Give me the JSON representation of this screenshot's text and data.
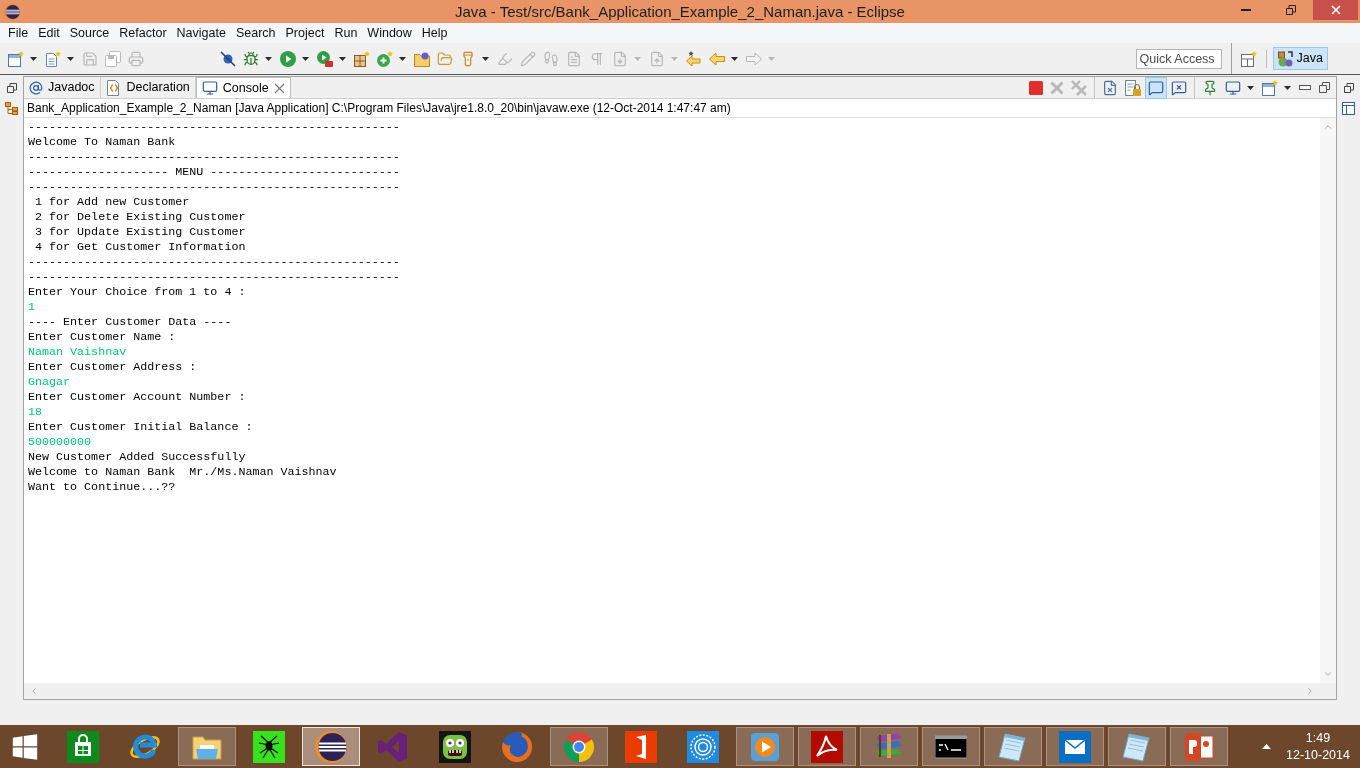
{
  "window": {
    "title": "Java - Test/src/Bank_Application_Example_2_Naman.java - Eclipse"
  },
  "menu_bar": [
    "File",
    "Edit",
    "Source",
    "Refactor",
    "Navigate",
    "Search",
    "Project",
    "Run",
    "Window",
    "Help"
  ],
  "toolbar": {
    "groups": [
      [
        {
          "kind": "new",
          "dropdown": true,
          "disabled": false
        },
        {
          "kind": "new-file",
          "dropdown": true,
          "disabled": false
        },
        {
          "kind": "save",
          "dropdown": false,
          "disabled": true
        },
        {
          "kind": "save-all",
          "dropdown": false,
          "disabled": true
        },
        {
          "kind": "print",
          "dropdown": false,
          "disabled": true
        }
      ],
      [
        {
          "kind": "skip-breakpoints",
          "dropdown": false,
          "disabled": false
        },
        {
          "kind": "debug",
          "dropdown": true,
          "disabled": false
        },
        {
          "kind": "run",
          "dropdown": true,
          "disabled": false
        },
        {
          "kind": "external-tools",
          "dropdown": true,
          "disabled": false
        },
        {
          "kind": "new-project",
          "dropdown": false,
          "disabled": false
        },
        {
          "kind": "new-class",
          "dropdown": true,
          "disabled": false
        },
        {
          "kind": "open-type",
          "dropdown": false,
          "disabled": false
        },
        {
          "kind": "open-task",
          "dropdown": false,
          "disabled": false
        },
        {
          "kind": "search",
          "dropdown": true,
          "disabled": false
        },
        {
          "kind": "mark-occurrences",
          "dropdown": false,
          "disabled": true
        },
        {
          "kind": "edit",
          "dropdown": false,
          "disabled": true
        },
        {
          "kind": "breadcrumb",
          "dropdown": false,
          "disabled": true
        },
        {
          "kind": "source-only",
          "dropdown": false,
          "disabled": true
        },
        {
          "kind": "whitespace",
          "dropdown": false,
          "disabled": true
        },
        {
          "kind": "next-annotation",
          "dropdown": true,
          "disabled": true
        },
        {
          "kind": "previous-annotation",
          "dropdown": true,
          "disabled": true
        },
        {
          "kind": "last-edit",
          "dropdown": false,
          "disabled": false
        },
        {
          "kind": "back",
          "dropdown": true,
          "disabled": false
        },
        {
          "kind": "forward",
          "dropdown": true,
          "disabled": true
        }
      ]
    ],
    "quick_access": {
      "placeholder": "Quick Access"
    },
    "perspectives": [
      {
        "label": "Java",
        "selected": true
      }
    ]
  },
  "view": {
    "tabs": [
      {
        "kind": "javadoc",
        "label": "Javadoc",
        "selected": false
      },
      {
        "kind": "declaration",
        "label": "Declaration",
        "selected": false
      },
      {
        "kind": "console",
        "label": "Console",
        "selected": true
      }
    ],
    "toolbar_groups": [
      [
        {
          "kind": "terminate",
          "dropdown": false,
          "disabled": false,
          "selected": false
        },
        {
          "kind": "remove-launch",
          "dropdown": false,
          "disabled": true,
          "selected": false
        },
        {
          "kind": "remove-all",
          "dropdown": false,
          "disabled": true,
          "selected": false
        }
      ],
      [
        {
          "kind": "clear",
          "dropdown": false,
          "disabled": false,
          "selected": false
        },
        {
          "kind": "scroll-lock",
          "dropdown": false,
          "disabled": false,
          "selected": false
        },
        {
          "kind": "show-stdout",
          "dropdown": false,
          "disabled": false,
          "selected": true
        },
        {
          "kind": "show-stderr",
          "dropdown": false,
          "disabled": false,
          "selected": false
        }
      ],
      [
        {
          "kind": "pin",
          "dropdown": false,
          "disabled": false,
          "selected": false
        },
        {
          "kind": "display",
          "dropdown": true,
          "disabled": false,
          "selected": false
        },
        {
          "kind": "open-console",
          "dropdown": true,
          "disabled": false,
          "selected": false
        }
      ]
    ],
    "process": "Bank_Application_Example_2_Naman [Java Application] C:\\Program Files\\Java\\jre1.8.0_20\\bin\\javaw.exe (12-Oct-2014 1:47:47 am)",
    "lines": [
      {
        "kind": "output",
        "text": "-----------------------------------------------------"
      },
      {
        "kind": "output",
        "text": "Welcome To Naman Bank"
      },
      {
        "kind": "output",
        "text": "-----------------------------------------------------"
      },
      {
        "kind": "output",
        "text": "-------------------- MENU ---------------------------"
      },
      {
        "kind": "output",
        "text": "-----------------------------------------------------"
      },
      {
        "kind": "output",
        "text": " 1 for Add new Customer"
      },
      {
        "kind": "output",
        "text": " 2 for Delete Existing Customer"
      },
      {
        "kind": "output",
        "text": " 3 for Update Existing Customer"
      },
      {
        "kind": "output",
        "text": " 4 for Get Customer Information"
      },
      {
        "kind": "output",
        "text": "-----------------------------------------------------"
      },
      {
        "kind": "output",
        "text": "-----------------------------------------------------"
      },
      {
        "kind": "output",
        "text": "Enter Your Choice from 1 to 4 :"
      },
      {
        "kind": "input",
        "text": "1"
      },
      {
        "kind": "output",
        "text": "---- Enter Customer Data ----"
      },
      {
        "kind": "output",
        "text": "Enter Customer Name :"
      },
      {
        "kind": "input",
        "text": "Naman Vaishnav"
      },
      {
        "kind": "output",
        "text": "Enter Customer Address :"
      },
      {
        "kind": "input",
        "text": "Gnagar"
      },
      {
        "kind": "output",
        "text": "Enter Customer Account Number :"
      },
      {
        "kind": "input",
        "text": "18"
      },
      {
        "kind": "output",
        "text": "Enter Customer Initial Balance :"
      },
      {
        "kind": "input",
        "text": "500000000"
      },
      {
        "kind": "output",
        "text": "New Customer Added Successfully"
      },
      {
        "kind": "output",
        "text": "Welcome to Naman Bank  Mr./Ms.Naman Vaishnav"
      },
      {
        "kind": "output",
        "text": "Want to Continue...??"
      }
    ]
  },
  "taskbar": {
    "buttons": [
      {
        "kind": "start",
        "open": false,
        "selected": false
      },
      {
        "kind": "store",
        "open": false,
        "selected": false
      },
      {
        "kind": "ie",
        "open": false,
        "selected": false
      },
      {
        "kind": "explorer",
        "open": true,
        "selected": false
      },
      {
        "kind": "spider",
        "open": false,
        "selected": false
      },
      {
        "kind": "eclipse",
        "open": true,
        "selected": true
      },
      {
        "kind": "studio",
        "open": false,
        "selected": false
      },
      {
        "kind": "monster",
        "open": false,
        "selected": false
      },
      {
        "kind": "firefox",
        "open": false,
        "selected": false
      },
      {
        "kind": "chrome",
        "open": true,
        "selected": false
      },
      {
        "kind": "office",
        "open": false,
        "selected": false
      },
      {
        "kind": "disc",
        "open": false,
        "selected": false
      },
      {
        "kind": "media",
        "open": true,
        "selected": false
      },
      {
        "kind": "acrobat",
        "open": true,
        "selected": false
      },
      {
        "kind": "archive",
        "open": true,
        "selected": false
      },
      {
        "kind": "terminal",
        "open": true,
        "selected": false
      },
      {
        "kind": "notepad",
        "open": true,
        "selected": false
      },
      {
        "kind": "mail",
        "open": true,
        "selected": false
      },
      {
        "kind": "notepad",
        "open": true,
        "selected": false
      },
      {
        "kind": "slides",
        "open": true,
        "selected": false
      }
    ],
    "clock": {
      "time": "1:49",
      "date": "12-10-2014"
    }
  }
}
